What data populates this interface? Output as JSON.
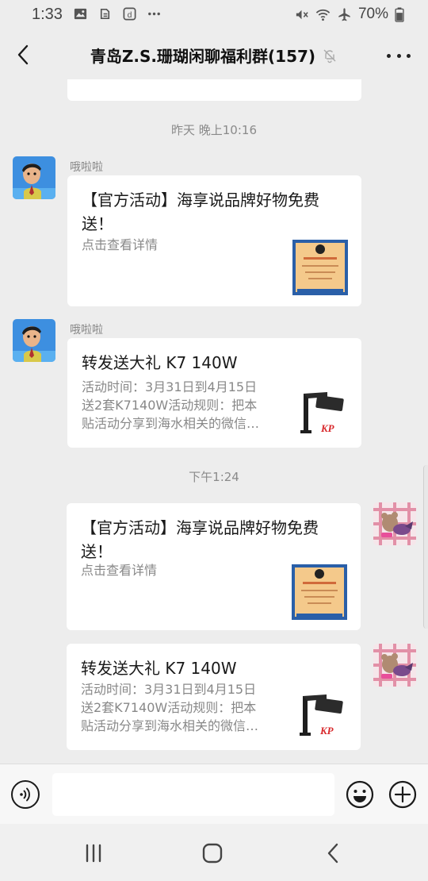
{
  "status_bar": {
    "time": "1:33",
    "battery": "70%",
    "left_icons": [
      "image-icon",
      "notification-icon",
      "d-app-icon",
      "more-dots-icon"
    ],
    "right_icons": [
      "mute-icon",
      "wifi-icon",
      "airplane-icon",
      "battery-icon"
    ]
  },
  "header": {
    "title": "青岛Z.S.珊瑚闲聊福利群(157)",
    "muted_icon": "bell-off-icon"
  },
  "messages": [
    {
      "type": "timestamp",
      "text": "昨天 晚上10:16"
    },
    {
      "type": "card",
      "side": "left",
      "sender": "哦啦啦",
      "title": "【官方活动】海享说品牌好物免费送！",
      "description": "点击查看详情",
      "thumb": "poster-thumbnail"
    },
    {
      "type": "card",
      "side": "left",
      "sender": "哦啦啦",
      "title": "转发送大礼 K7 140W",
      "description_lines": [
        "活动时间：3月31日到4月15日",
        "送2套K7140W活动规则：把本",
        "贴活动分享到海水相关的微信…"
      ],
      "thumb": "lamp-thumbnail"
    },
    {
      "type": "timestamp",
      "text": "下午1:24"
    },
    {
      "type": "card",
      "side": "right",
      "title": "【官方活动】海享说品牌好物免费送！",
      "description": "点击查看详情",
      "thumb": "poster-thumbnail"
    },
    {
      "type": "card",
      "side": "right",
      "title": "转发送大礼 K7 140W",
      "description_lines": [
        "活动时间：3月31日到4月15日",
        "送2套K7140W活动规则：把本",
        "贴活动分享到海水相关的微信…"
      ],
      "thumb": "lamp-thumbnail"
    }
  ],
  "input_bar": {
    "placeholder": "",
    "icons": [
      "voice-icon",
      "emoji-icon",
      "plus-icon"
    ]
  },
  "colors": {
    "background": "#ededed",
    "card": "#ffffff",
    "timestamp_text": "#8a8a8a",
    "sender_text": "#888888"
  }
}
